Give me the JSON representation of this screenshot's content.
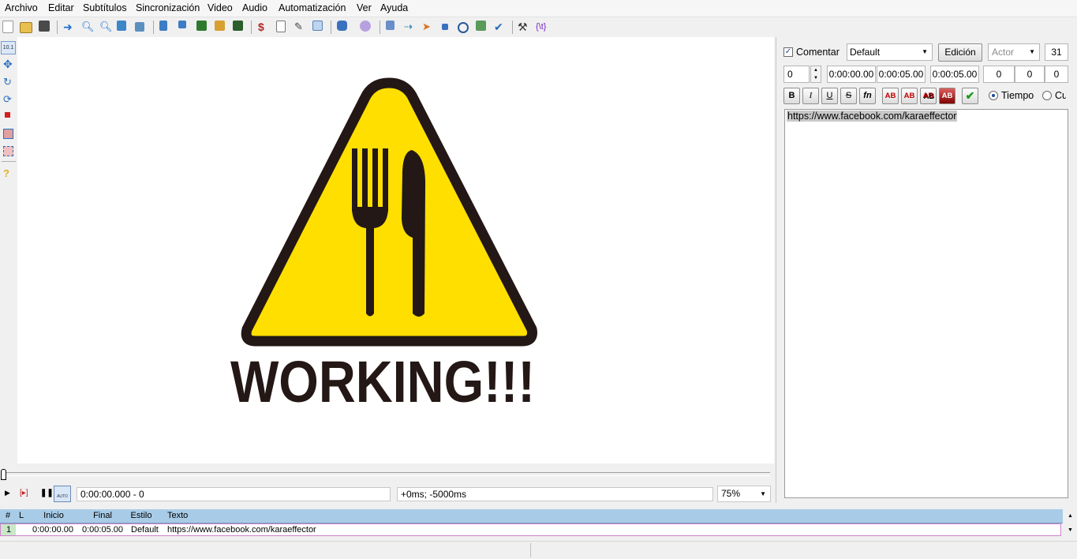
{
  "menu": [
    "Archivo",
    "Editar",
    "Subtítulos",
    "Sincronización",
    "Video",
    "Audio",
    "Automatización",
    "Ver",
    "Ayuda"
  ],
  "toolbar_icons": [
    "new-file-icon",
    "open-file-icon",
    "save-icon",
    "jump-icon",
    "zoom-in-icon",
    "zoom-out-icon",
    "snap-icon",
    "bucket-icon",
    "flag-blue-icon",
    "flag-icon",
    "film-green-icon",
    "film-orange-icon",
    "film-dark-icon",
    "dollar-icon",
    "clipboard-icon",
    "pen-icon",
    "copy-icon",
    "puzzle-icon",
    "avatar-icon",
    "insert-icon",
    "arrow-icon",
    "fish-icon",
    "stop-icon",
    "timer-icon",
    "resample-icon",
    "check-icon",
    "tools-icon",
    "t-macro-icon"
  ],
  "toolbar_macro_label": "{\\t}",
  "video": {
    "sign_text": "WORKING!!!",
    "accent_yellow": "#ffdf00",
    "sign_dark": "#231815"
  },
  "controls": {
    "time_display": "0:00:00.000 - 0",
    "offset_display": "+0ms; -5000ms",
    "zoom": "75%"
  },
  "editor": {
    "comment_label": "Comentar",
    "comment_checked": true,
    "style": "Default",
    "edit_button": "Edición",
    "actor_placeholder": "Actor",
    "effect_value": "31",
    "layer": "0",
    "start_time": "0:00:00.00",
    "end_time": "0:00:05.00",
    "duration": "0:00:05.00",
    "margin_l": "0",
    "margin_r": "0",
    "margin_v": "0",
    "fmt_bold": "B",
    "fmt_italic": "I",
    "fmt_underline": "U",
    "fmt_strike": "S",
    "fmt_font": "fn",
    "fmt_color": "AB",
    "radio_time": "Tiempo",
    "radio_frames": "Cu",
    "text": "https://www.facebook.com/karaeffector"
  },
  "grid": {
    "headers": [
      "#",
      "L",
      "Inicio",
      "Final",
      "Estilo",
      "Texto"
    ],
    "rows": [
      {
        "num": "1",
        "layer": "",
        "start": "0:00:00.00",
        "end": "0:00:05.00",
        "style": "Default",
        "text": "https://www.facebook.com/karaeffector"
      }
    ]
  }
}
